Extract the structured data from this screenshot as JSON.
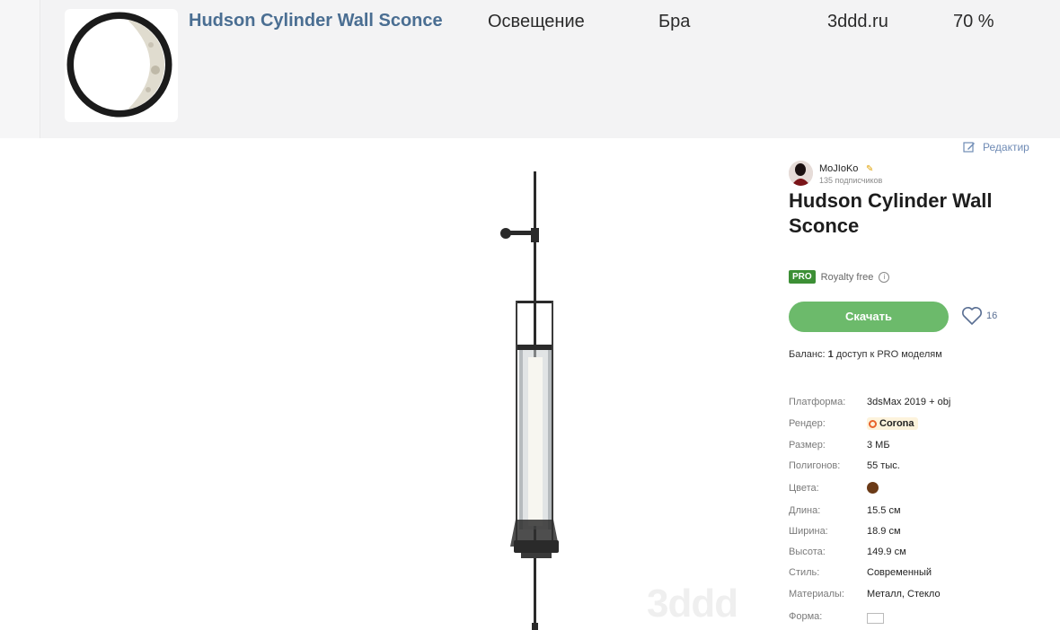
{
  "result_row": {
    "title": "Hudson Cylinder Wall Sconce",
    "category": "Освещение",
    "subcategory": "Бра",
    "source": "3ddd.ru",
    "match": "70 %"
  },
  "product": {
    "edit_label": "Редактир",
    "author": {
      "name": "MoJIoKo",
      "subscribers": "135 подписчиков"
    },
    "title": "Hudson Cylinder Wall Sconce",
    "pro_badge": "PRO",
    "license": "Royalty free",
    "download_label": "Скачать",
    "likes": "16",
    "balance_prefix": "Баланс:",
    "balance_count": "1",
    "balance_suffix": "доступ к PRO моделям",
    "specs": [
      {
        "label": "Платформа:",
        "value": "3dsMax 2019 + obj"
      },
      {
        "label": "Рендер:",
        "value": "Corona"
      },
      {
        "label": "Размер:",
        "value": "3 МБ"
      },
      {
        "label": "Полигонов:",
        "value": "55 тыс."
      },
      {
        "label": "Цвета:",
        "value": ""
      },
      {
        "label": "Длина:",
        "value": "15.5 см"
      },
      {
        "label": "Ширина:",
        "value": "18.9 см"
      },
      {
        "label": "Высота:",
        "value": "149.9 см"
      },
      {
        "label": "Стиль:",
        "value": "Современный"
      },
      {
        "label": "Материалы:",
        "value": "Металл, Стекло"
      },
      {
        "label": "Форма:",
        "value": ""
      }
    ],
    "color_swatch": "#6b3a17",
    "watermark": "3ddd"
  },
  "colors": {
    "link": "#4a6e92",
    "button": "#6cba6b",
    "pro": "#3c8f35"
  },
  "icons": [
    "edit-icon",
    "heart-icon",
    "info-icon",
    "corona-icon"
  ]
}
